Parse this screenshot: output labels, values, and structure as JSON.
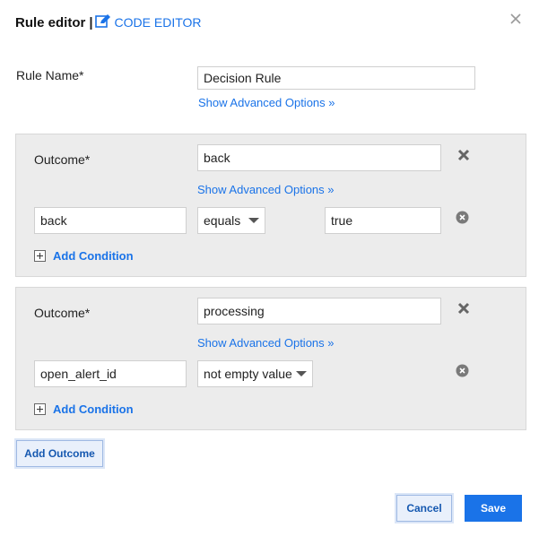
{
  "header": {
    "title": "Rule editor",
    "separator": "|",
    "code_editor_label": "CODE EDITOR"
  },
  "rule": {
    "name_label": "Rule Name*",
    "name_value": "Decision Rule",
    "advanced_link": "Show Advanced Options »"
  },
  "outcomes": [
    {
      "label": "Outcome*",
      "value": "back",
      "advanced_link": "Show Advanced Options »",
      "condition": {
        "field": "back",
        "operator": "equals",
        "value": "true"
      },
      "add_condition_label": "Add Condition"
    },
    {
      "label": "Outcome*",
      "value": "processing",
      "advanced_link": "Show Advanced Options »",
      "condition": {
        "field": "open_alert_id",
        "operator": "not empty value"
      },
      "add_condition_label": "Add Condition"
    }
  ],
  "actions": {
    "add_outcome_label": "Add Outcome",
    "cancel_label": "Cancel",
    "save_label": "Save"
  },
  "colors": {
    "accent": "#1a73e8",
    "panel_bg": "#ececec",
    "icon_gray": "#707070"
  }
}
